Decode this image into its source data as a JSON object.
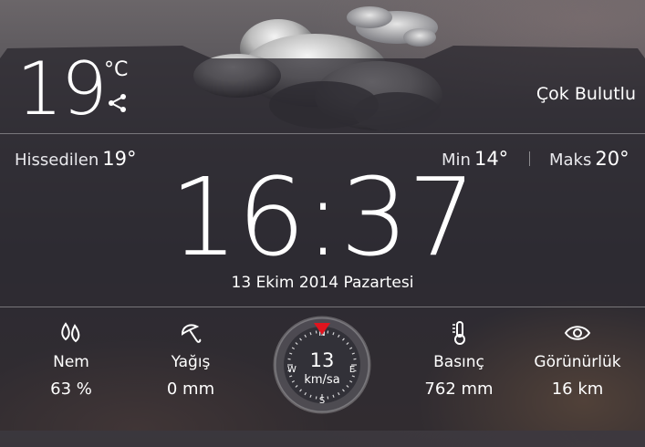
{
  "current": {
    "temperature": "19",
    "unit": "°C",
    "condition": "Çok Bulutlu",
    "feels_like_label": "Hissedilen",
    "feels_like_value": "19°",
    "min_label": "Min",
    "min_value": "14°",
    "max_label": "Maks",
    "max_value": "20°"
  },
  "clock": {
    "time": "16:37",
    "date": "13 Ekim 2014 Pazartesi"
  },
  "stats": [
    {
      "label": "Nem",
      "value": "63 %",
      "icon": "humidity-drops-icon"
    },
    {
      "label": "Yağış",
      "value": "0 mm",
      "icon": "umbrella-icon"
    },
    {
      "label": "Basınç",
      "value": "762 mm",
      "icon": "thermometer-icon"
    },
    {
      "label": "Görünürlük",
      "value": "16 km",
      "icon": "eye-icon"
    }
  ],
  "wind": {
    "speed": "13",
    "unit": "km/sa",
    "compass": [
      "N",
      "E",
      "S",
      "W"
    ],
    "direction_deg": 0
  },
  "colors": {
    "wind_indicator": "#e0141e"
  }
}
